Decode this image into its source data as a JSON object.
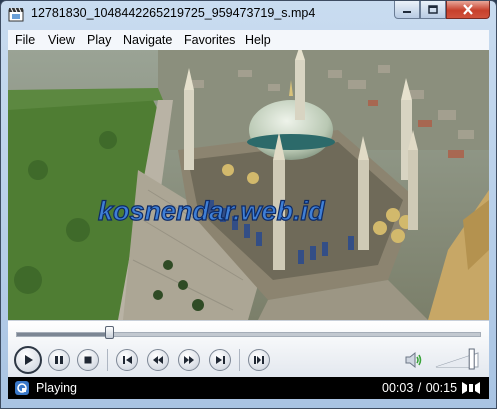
{
  "window": {
    "title": "12781830_1048442265219725_959473719_s.mp4",
    "app_icon": "film-clip-icon",
    "caption_buttons": [
      "minimize-icon",
      "maximize-icon",
      "close-icon"
    ]
  },
  "menu": {
    "items": [
      "File",
      "View",
      "Play",
      "Navigate",
      "Favorites",
      "Help"
    ]
  },
  "video": {
    "watermark": "kosnendar.web.id",
    "colors": {
      "grass": "#4d7a32",
      "dome": "#c9d7c4",
      "sky_haze": "#8f9a8c",
      "gold": "#d1b56a"
    }
  },
  "controls": {
    "seek_fraction": 0.2,
    "buttons": [
      "play-icon",
      "pause-icon",
      "stop-icon",
      "skip-previous-icon",
      "rewind-icon",
      "fast-forward-icon",
      "skip-next-icon",
      "frame-step-icon"
    ],
    "volume_icon": "speaker-icon",
    "volume_level": 0.85
  },
  "status": {
    "state": "Playing",
    "elapsed": "00:03",
    "separator": "/",
    "total": "00:15",
    "fullscreen_icon": "fullscreen-icon"
  }
}
